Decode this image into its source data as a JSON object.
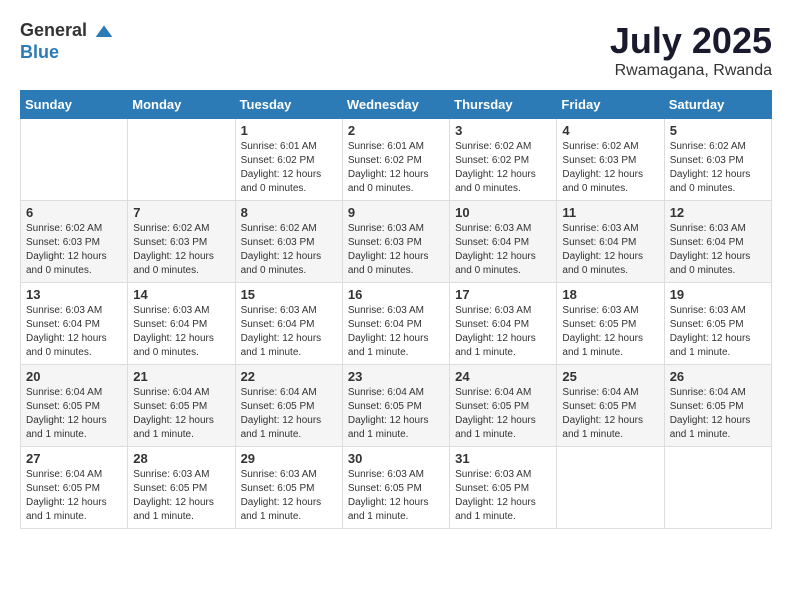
{
  "header": {
    "logo_general": "General",
    "logo_blue": "Blue",
    "month_year": "July 2025",
    "location": "Rwamagana, Rwanda"
  },
  "days_of_week": [
    "Sunday",
    "Monday",
    "Tuesday",
    "Wednesday",
    "Thursday",
    "Friday",
    "Saturday"
  ],
  "weeks": [
    [
      {
        "day": "",
        "info": ""
      },
      {
        "day": "",
        "info": ""
      },
      {
        "day": "1",
        "info": "Sunrise: 6:01 AM\nSunset: 6:02 PM\nDaylight: 12 hours and 0 minutes."
      },
      {
        "day": "2",
        "info": "Sunrise: 6:01 AM\nSunset: 6:02 PM\nDaylight: 12 hours and 0 minutes."
      },
      {
        "day": "3",
        "info": "Sunrise: 6:02 AM\nSunset: 6:02 PM\nDaylight: 12 hours and 0 minutes."
      },
      {
        "day": "4",
        "info": "Sunrise: 6:02 AM\nSunset: 6:03 PM\nDaylight: 12 hours and 0 minutes."
      },
      {
        "day": "5",
        "info": "Sunrise: 6:02 AM\nSunset: 6:03 PM\nDaylight: 12 hours and 0 minutes."
      }
    ],
    [
      {
        "day": "6",
        "info": "Sunrise: 6:02 AM\nSunset: 6:03 PM\nDaylight: 12 hours and 0 minutes."
      },
      {
        "day": "7",
        "info": "Sunrise: 6:02 AM\nSunset: 6:03 PM\nDaylight: 12 hours and 0 minutes."
      },
      {
        "day": "8",
        "info": "Sunrise: 6:02 AM\nSunset: 6:03 PM\nDaylight: 12 hours and 0 minutes."
      },
      {
        "day": "9",
        "info": "Sunrise: 6:03 AM\nSunset: 6:03 PM\nDaylight: 12 hours and 0 minutes."
      },
      {
        "day": "10",
        "info": "Sunrise: 6:03 AM\nSunset: 6:04 PM\nDaylight: 12 hours and 0 minutes."
      },
      {
        "day": "11",
        "info": "Sunrise: 6:03 AM\nSunset: 6:04 PM\nDaylight: 12 hours and 0 minutes."
      },
      {
        "day": "12",
        "info": "Sunrise: 6:03 AM\nSunset: 6:04 PM\nDaylight: 12 hours and 0 minutes."
      }
    ],
    [
      {
        "day": "13",
        "info": "Sunrise: 6:03 AM\nSunset: 6:04 PM\nDaylight: 12 hours and 0 minutes."
      },
      {
        "day": "14",
        "info": "Sunrise: 6:03 AM\nSunset: 6:04 PM\nDaylight: 12 hours and 0 minutes."
      },
      {
        "day": "15",
        "info": "Sunrise: 6:03 AM\nSunset: 6:04 PM\nDaylight: 12 hours and 1 minute."
      },
      {
        "day": "16",
        "info": "Sunrise: 6:03 AM\nSunset: 6:04 PM\nDaylight: 12 hours and 1 minute."
      },
      {
        "day": "17",
        "info": "Sunrise: 6:03 AM\nSunset: 6:04 PM\nDaylight: 12 hours and 1 minute."
      },
      {
        "day": "18",
        "info": "Sunrise: 6:03 AM\nSunset: 6:05 PM\nDaylight: 12 hours and 1 minute."
      },
      {
        "day": "19",
        "info": "Sunrise: 6:03 AM\nSunset: 6:05 PM\nDaylight: 12 hours and 1 minute."
      }
    ],
    [
      {
        "day": "20",
        "info": "Sunrise: 6:04 AM\nSunset: 6:05 PM\nDaylight: 12 hours and 1 minute."
      },
      {
        "day": "21",
        "info": "Sunrise: 6:04 AM\nSunset: 6:05 PM\nDaylight: 12 hours and 1 minute."
      },
      {
        "day": "22",
        "info": "Sunrise: 6:04 AM\nSunset: 6:05 PM\nDaylight: 12 hours and 1 minute."
      },
      {
        "day": "23",
        "info": "Sunrise: 6:04 AM\nSunset: 6:05 PM\nDaylight: 12 hours and 1 minute."
      },
      {
        "day": "24",
        "info": "Sunrise: 6:04 AM\nSunset: 6:05 PM\nDaylight: 12 hours and 1 minute."
      },
      {
        "day": "25",
        "info": "Sunrise: 6:04 AM\nSunset: 6:05 PM\nDaylight: 12 hours and 1 minute."
      },
      {
        "day": "26",
        "info": "Sunrise: 6:04 AM\nSunset: 6:05 PM\nDaylight: 12 hours and 1 minute."
      }
    ],
    [
      {
        "day": "27",
        "info": "Sunrise: 6:04 AM\nSunset: 6:05 PM\nDaylight: 12 hours and 1 minute."
      },
      {
        "day": "28",
        "info": "Sunrise: 6:03 AM\nSunset: 6:05 PM\nDaylight: 12 hours and 1 minute."
      },
      {
        "day": "29",
        "info": "Sunrise: 6:03 AM\nSunset: 6:05 PM\nDaylight: 12 hours and 1 minute."
      },
      {
        "day": "30",
        "info": "Sunrise: 6:03 AM\nSunset: 6:05 PM\nDaylight: 12 hours and 1 minute."
      },
      {
        "day": "31",
        "info": "Sunrise: 6:03 AM\nSunset: 6:05 PM\nDaylight: 12 hours and 1 minute."
      },
      {
        "day": "",
        "info": ""
      },
      {
        "day": "",
        "info": ""
      }
    ]
  ]
}
